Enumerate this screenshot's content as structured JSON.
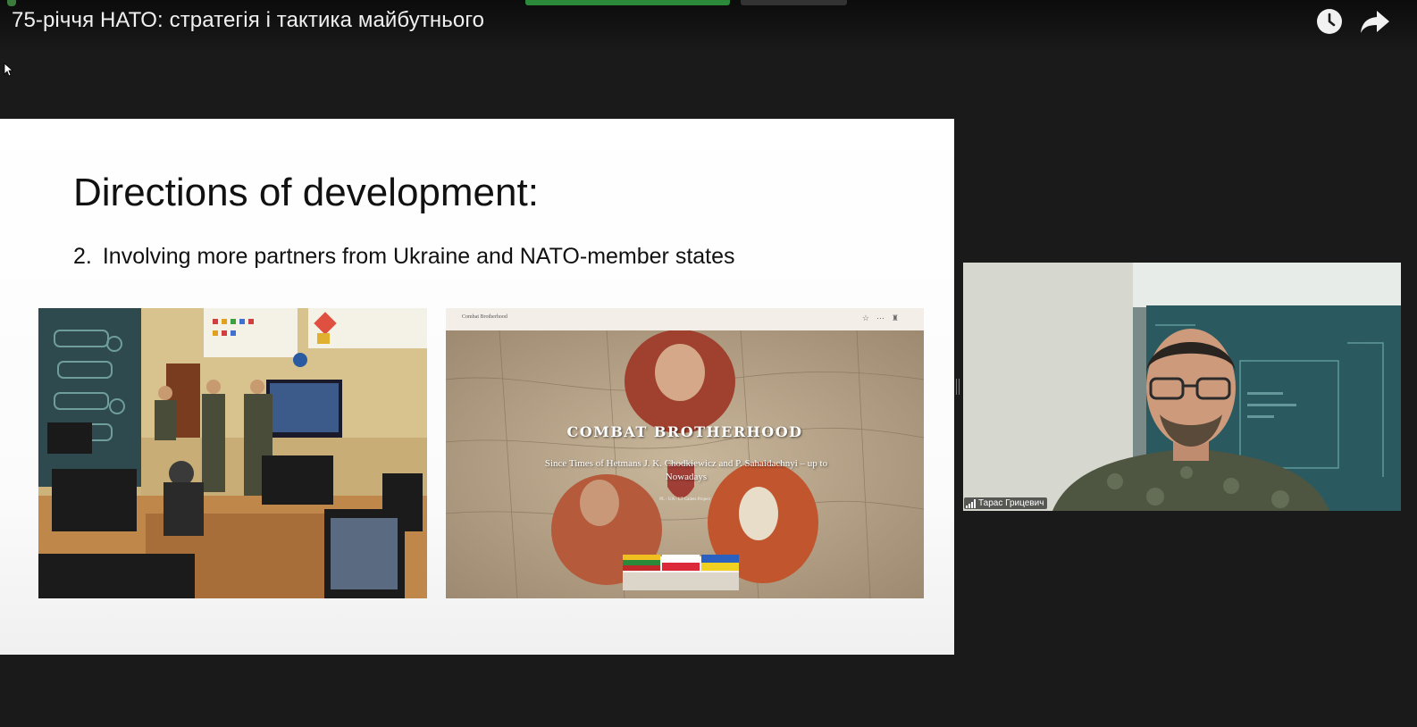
{
  "video": {
    "title": "75-річчя НАТО: стратегія і тактика майбутнього",
    "buttons": {
      "watch_later": "clock-icon",
      "share": "share-icon"
    }
  },
  "slide": {
    "title": "Directions of development:",
    "point_number": "2.",
    "point_text": "Involving more partners from Ukraine and NATO-member states"
  },
  "website_screenshot": {
    "site_name": "Combat Brotherhood",
    "heading": "COMBAT BROTHERHOOD",
    "subtitle": "Since Times of Hetmans J. K. Chodkiewicz and P. Sahaidachnyi – up to Nowadays",
    "project_line": "PL - UA - LT Cadets Project",
    "flags": [
      "lithuania",
      "poland",
      "ukraine"
    ]
  },
  "participant": {
    "name": "Тарас Грицевич",
    "signal_icon": "signal-icon"
  },
  "colors": {
    "background": "#1a1a1a",
    "slide_background": "#ffffff",
    "accent_green": "#2a8a3a"
  }
}
